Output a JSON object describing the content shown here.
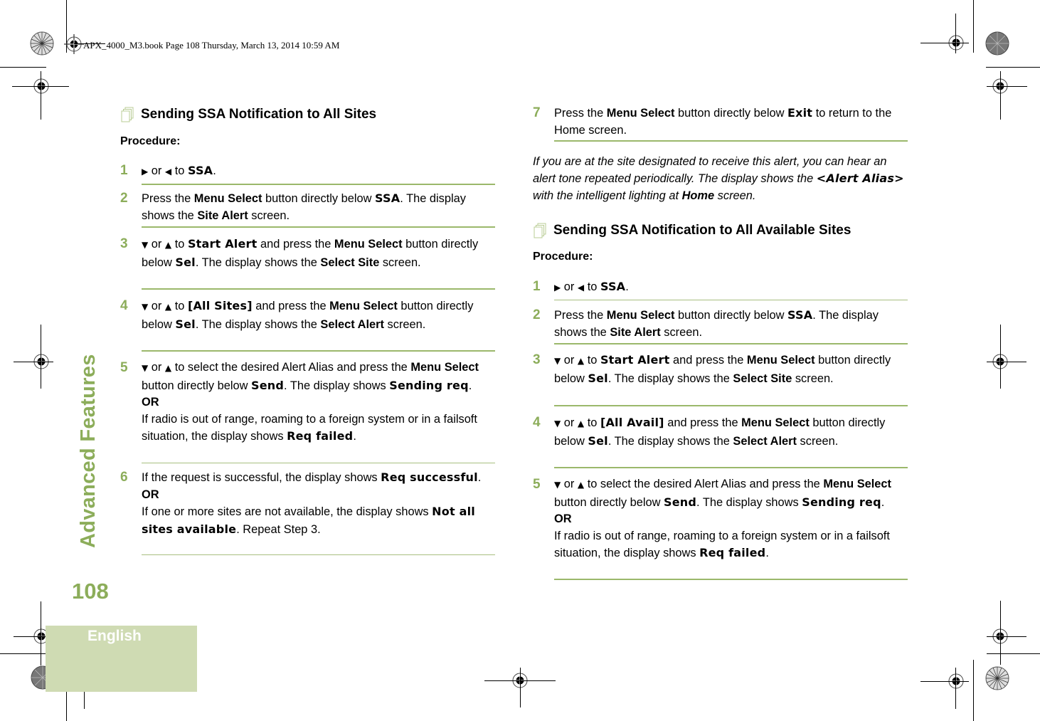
{
  "header": {
    "slug": "APX_4000_M3.book  Page 108  Thursday, March 13, 2014  10:59 AM"
  },
  "side": {
    "chapter_title": "Advanced Features",
    "page_number": "108",
    "language": "English"
  },
  "colors": {
    "accent_green": "#8cad5a",
    "rule_green": "#9bb86b",
    "lang_box": "#cfdbb3"
  },
  "icons": {
    "right_arrow": "right-nav-arrow",
    "left_arrow": "left-nav-arrow",
    "down_arrow": "down-nav-arrow",
    "up_arrow": "up-nav-arrow",
    "section": "document-stack-icon"
  },
  "left": {
    "title": "Sending SSA Notification to All Sites",
    "procedure_label": "Procedure:",
    "steps": [
      {
        "num": "1",
        "parts": {
          "or": " or ",
          "to": " to ",
          "target": "SSA",
          "end": "."
        }
      },
      {
        "num": "2",
        "parts": {
          "a": "Press the ",
          "menu": "Menu Select",
          "b": " button directly below ",
          "lcd": "SSA",
          "c": ". The display shows the ",
          "screen": "Site Alert",
          "d": " screen."
        }
      },
      {
        "num": "3",
        "parts": {
          "or": " or ",
          "to": "  to ",
          "lcd": "Start Alert",
          "a": " and press the ",
          "menu": "Menu Select",
          "b": " button directly below ",
          "sel": "Sel",
          "c": ". The display shows the ",
          "screen": "Select Site",
          "d": " screen."
        }
      },
      {
        "num": "4",
        "parts": {
          "or": " or ",
          "to": "  to ",
          "lcd": "[All Sites]",
          "a": " and press the ",
          "menu": "Menu Select",
          "b": " button directly below ",
          "sel": "Sel",
          "c": ". The display shows the ",
          "screen": "Select Alert",
          "d": " screen."
        }
      },
      {
        "num": "5",
        "parts": {
          "or": " or ",
          "a": "  to select the desired Alert Alias and press the ",
          "menu": "Menu Select",
          "b": " button directly below ",
          "send": "Send",
          "c": ". The display shows ",
          "sending": "Sending req",
          "d": ".",
          "or_label": "OR",
          "e": "If radio is out of range, roaming to a foreign system or in a failsoft situation, the display shows ",
          "failed": "Req failed",
          "f": "."
        }
      },
      {
        "num": "6",
        "parts": {
          "a": "If the request is successful, the display shows ",
          "success": "Req successful",
          "b": ".",
          "or_label": "OR",
          "c": "If one or more sites are not available, the display shows ",
          "notall": "Not all sites available",
          "d": ". Repeat Step 3."
        }
      }
    ]
  },
  "right": {
    "step7": {
      "num": "7",
      "parts": {
        "a": "Press the ",
        "menu": "Menu Select",
        "b": " button directly below ",
        "exit": "Exit",
        "c": " to return to the Home screen."
      }
    },
    "note": {
      "a": "If you are at the site designated to receive this alert, you can hear an alert tone repeated periodically. The display shows the ",
      "alias": "<Alert Alias>",
      "b": " with the intelligent lighting at ",
      "home": "Home",
      "c": " screen."
    },
    "title": "Sending SSA Notification to All Available Sites",
    "procedure_label": "Procedure:",
    "steps": [
      {
        "num": "1",
        "parts": {
          "or": " or ",
          "to": " to ",
          "target": "SSA",
          "end": "."
        }
      },
      {
        "num": "2",
        "parts": {
          "a": "Press the ",
          "menu": "Menu Select",
          "b": " button directly below ",
          "lcd": "SSA",
          "c": ". The display shows the ",
          "screen": "Site Alert",
          "d": " screen."
        }
      },
      {
        "num": "3",
        "parts": {
          "or": " or ",
          "to": "  to ",
          "lcd": "Start Alert",
          "a": " and press the ",
          "menu": "Menu Select",
          "b": " button directly below ",
          "sel": "Sel",
          "c": ". The display shows the ",
          "screen": "Select Site",
          "d": " screen."
        }
      },
      {
        "num": "4",
        "parts": {
          "or": " or ",
          "to": "  to ",
          "lcd": "[All Avail]",
          "a": " and press the ",
          "menu": "Menu Select",
          "b": " button directly below ",
          "sel": "Sel",
          "c": ". The display shows the ",
          "screen": "Select Alert",
          "d": " screen."
        }
      },
      {
        "num": "5",
        "parts": {
          "or": " or ",
          "a": "  to select the desired Alert Alias and press the ",
          "menu": "Menu Select",
          "b": " button directly below ",
          "send": "Send",
          "c": ". The display shows ",
          "sending": "Sending req",
          "d": ".",
          "or_label": "OR",
          "e": "If radio is out of range, roaming to a foreign system or in a failsoft situation, the display shows ",
          "failed": "Req failed",
          "f": "."
        }
      }
    ]
  }
}
